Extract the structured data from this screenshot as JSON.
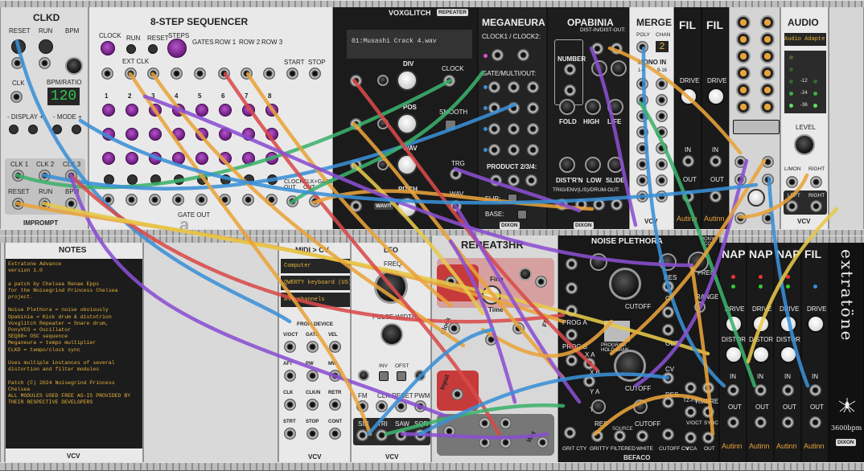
{
  "clkd": {
    "title": "CLKD",
    "reset": "RESET",
    "run": "RUN",
    "bpm": "BPM",
    "clk": "CLK",
    "bpm_ratio": "BPM/RATIO",
    "display": "120",
    "display_label": "- DISPLAY +",
    "mode_label": "- MODE +",
    "clk1": "CLK 1",
    "clk2": "CLK 2",
    "clk3": "CLK 3",
    "reset2": "RESET",
    "run2": "RUN",
    "bpm2": "BPM",
    "brand": "IMPROMPT"
  },
  "seq": {
    "title": "8-STEP SEQUENCER",
    "clock": "CLOCK",
    "run": "RUN",
    "reset": "RESET",
    "steps": "STEPS",
    "ext_clk": "EXT CLK",
    "gates": "GATES",
    "row1": "ROW 1",
    "row2": "ROW 2",
    "row3": "ROW 3",
    "start": "START",
    "stop": "STOP",
    "steps_nums": [
      "1",
      "2",
      "3",
      "4",
      "5",
      "6",
      "7",
      "8"
    ],
    "clock_out": "CLOCK OUT",
    "clk_gate_out": "CLK+GATE OUT",
    "gate_out": "GATE OUT",
    "logo": "a"
  },
  "vox": {
    "brand": "VOXGLITCH",
    "sub": "REPEATER",
    "file": "01:Musashi Crack 4.wav",
    "div": "DIV",
    "pos": "POS",
    "wav": "WAV",
    "pitch": "PITCH",
    "clock": "CLOCK",
    "smooth": "SMOOTH",
    "trg": "TRG",
    "wav2": "WAV",
    "wavt": "WAV/T"
  },
  "meg": {
    "title": "MEGANEURA",
    "clock": "CLOCK1 / CLOCK2:",
    "gate": "GATE/MULTI/OUT:",
    "product": "PRODUCT 2/3/4:",
    "flip": "FLIP:",
    "base": "BASE:",
    "brand": "DIXON"
  },
  "opa": {
    "title": "OPABINIA",
    "dist": "DIST-IN/DIST-OUT:",
    "number": "NUMBER",
    "fold": "FOLD",
    "high": "HIGH",
    "life": "LIFE",
    "distrn": "DIST'R'N",
    "low": "LOW",
    "slide": "SLIDE",
    "trig": "TRIG/ENV(L/S)/DRUM-OUT:"
  },
  "merge": {
    "title": "MERGE",
    "poly": "POLY",
    "chan": "CHAN",
    "chan_val": "2",
    "mono_in": "MONO IN",
    "r1": "1-8",
    "r2": "9-16",
    "brand": "VCV"
  },
  "fil1": {
    "title": "FIL",
    "drive": "DRIVE",
    "in": "IN",
    "out": "OUT",
    "brand": "Autinn"
  },
  "fil2": {
    "title": "FIL",
    "drive": "DRIVE",
    "in": "IN",
    "out": "OUT",
    "brand": "Autinn"
  },
  "audio": {
    "title": "AUDIO",
    "device": "Audio Adapte",
    "db": [
      "-12",
      "-24",
      "-36"
    ],
    "level": "LEVEL",
    "lmon": "L/MON",
    "right": "RIGHT",
    "left": "LEFT",
    "right2": "RIGHT",
    "brand": "VCV"
  },
  "notes": {
    "title": "NOTES",
    "text": "Extratone Advance\nversion 1.0\n\na patch by Chelsea Renae Epps\nfor the Noisegrind Princess Chelsea\nproject.\n\nNoise Plethora = noise obviously\nOpabinia = Kick drum & distotrion\nVoxglitch Repeater = Snare drum,\nPonyVCO = Oscillator\nSEQ88= OSC sequence\nMeganeura = tempo multiplier\nCLKD = tempo/clock sync\n\nUses multiple instances of several\ndistortion and filter modules\n\nPatch (C) 2024 Noisegrind Princess\nChelsea\nALL MODULES USED FREE AS-IS PROVIDED BY\nTHEIR RESPECTIVE DEVELOPERS",
    "brand": "VCV"
  },
  "midi": {
    "title": "MIDI > CV",
    "driver": "Computer keyboard/mou",
    "device": "QWERTY keyboard (US)",
    "channel": "All channels",
    "from_device": "FROM DEVICE",
    "jacks": [
      "V/OCT",
      "GATE",
      "VEL",
      "AFT",
      "PW",
      "MW",
      "CLK",
      "CLK/N",
      "RETR",
      "STRT",
      "STOP",
      "CONT"
    ],
    "brand": "VCV"
  },
  "lfo": {
    "title": "LFO",
    "freq": "FREQ",
    "pulse_width": "PULSE WIDTH",
    "inv": "INV",
    "ofst": "OFST",
    "fm": "FM",
    "clk": "CLK",
    "reset": "RESET",
    "pwm": "PWM",
    "sin": "SIN",
    "tri": "TRI",
    "saw": "SAW",
    "sqr": "SQR",
    "brand": "VCV"
  },
  "rep": {
    "title": "REPEAT3HR",
    "fine": "Fine",
    "time": "Time",
    "clock": "Clock",
    "input": "Input",
    "fb": "FB",
    "wet": "Wet"
  },
  "np": {
    "title": "NOISE PLETHORA",
    "pony": "PONY VCO",
    "freq": "FREQ",
    "res": "RES",
    "cutoff": "CUTOFF",
    "cv": "CV",
    "prog_a": "PROG A",
    "prog_b": "PROG B",
    "program": "PROGRAM\nHOLD-BANK",
    "out": "OUT",
    "xa": "X A",
    "ya": "Y A",
    "xb": "X B",
    "yb": "Y B",
    "grit": "GRIT CTY",
    "gritty": "GRITTY",
    "filtered": "FILTERED",
    "white": "WHITE",
    "cutoff_cv": "CUTOFF CV",
    "range": "RANGE",
    "timbre": "TIMBRE",
    "tzfm": "TZ-FM",
    "voct": "V/OCT",
    "vca": "VCA",
    "sync": "SYNC",
    "brand": "BEFACO",
    "src": "SOURCE"
  },
  "nap1": {
    "title": "NAP",
    "drive": "DRIVE",
    "distort": "DISTORT",
    "in": "IN",
    "out": "OUT",
    "brand": "Autinn"
  },
  "nap2": {
    "title": "NAP",
    "drive": "DRIVE",
    "distort": "DISTORT",
    "in": "IN",
    "out": "OUT",
    "brand": "Autinn"
  },
  "nap3": {
    "title": "NAP",
    "drive": "DRIVE",
    "distort": "DISTORT",
    "in": "IN",
    "out": "OUT",
    "brand": "Autinn"
  },
  "fil3": {
    "title": "FIL",
    "drive": "DRIVE",
    "in": "IN",
    "out": "OUT",
    "brand": "Autinn"
  },
  "extra": {
    "title": "extratöne",
    "bpm": "3600bpm",
    "brand": "DIXON"
  },
  "colors": {
    "purple": "#7a2a93",
    "red": "#c73a3a",
    "orange": "#e8a33a",
    "cable_blue": "#3a8fd6",
    "cable_orange": "#e8a33a",
    "cable_purple": "#8a4fd0",
    "cable_red": "#d84a4a",
    "cable_green": "#3bb06b",
    "cable_yellow": "#e6c84a"
  }
}
